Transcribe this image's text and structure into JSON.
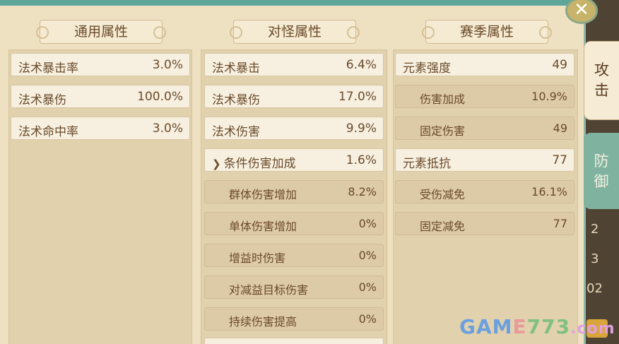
{
  "columns": [
    {
      "header": "通用属性",
      "rows": [
        {
          "label": "法术暴击率",
          "value": "3.0%"
        },
        {
          "label": "法术暴伤",
          "value": "100.0%"
        },
        {
          "label": "法术命中率",
          "value": "3.0%"
        }
      ]
    },
    {
      "header": "对怪属性",
      "rows": [
        {
          "label": "法术暴击",
          "value": "6.4%"
        },
        {
          "label": "法术暴伤",
          "value": "17.0%"
        },
        {
          "label": "法术伤害",
          "value": "9.9%"
        },
        {
          "label": "条件伤害加成",
          "value": "1.6%"
        },
        {
          "label": "群体伤害增加",
          "value": "8.2%"
        },
        {
          "label": "单体伤害增加",
          "value": "0%"
        },
        {
          "label": "增益时伤害",
          "value": "0%"
        },
        {
          "label": "对减益目标伤害",
          "value": "0%"
        },
        {
          "label": "持续伤害提高",
          "value": "0%"
        }
      ]
    },
    {
      "header": "赛季属性",
      "rows": [
        {
          "label": "元素强度",
          "value": "49"
        },
        {
          "label": "伤害加成",
          "value": "10.9%"
        },
        {
          "label": "固定伤害",
          "value": "49"
        },
        {
          "label": "元素抵抗",
          "value": "77"
        },
        {
          "label": "受伤减免",
          "value": "16.1%"
        },
        {
          "label": "固定减免",
          "value": "77"
        }
      ]
    }
  ],
  "tabs": {
    "attack": "攻击",
    "defense": "防御"
  },
  "icons": {
    "close": "close-icon",
    "expand": "chevron-down-icon"
  },
  "background_numbers": [
    "2",
    "3",
    "02"
  ],
  "watermark": {
    "part1": "GAM",
    "part2": "E",
    "part3": "773",
    "part4": ".com"
  },
  "colors": {
    "frame_accent": "#5fa69a",
    "text": "#6a4a2a",
    "tab_active": "#f6ecd6",
    "tab_inactive": "#7fb3a0"
  }
}
